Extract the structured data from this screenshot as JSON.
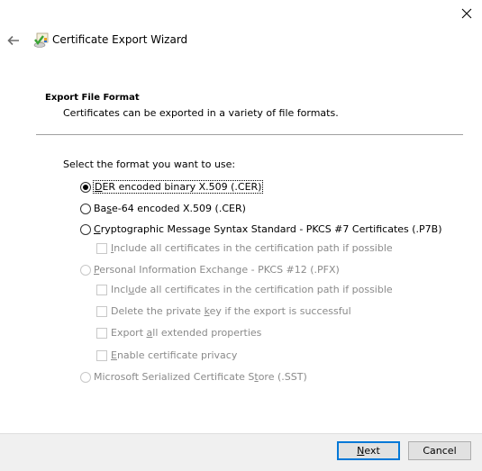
{
  "window": {
    "title": "Certificate Export Wizard",
    "back_icon": "arrow-left-icon",
    "close_icon": "close-icon",
    "app_icon": "certificate-export-icon"
  },
  "header": {
    "section_title": "Export File Format",
    "section_description": "Certificates can be exported in a variety of file formats."
  },
  "form": {
    "prompt": "Select the format you want to use:",
    "options": [
      {
        "label_accel": "D",
        "label_rest": "ER encoded binary X.509 (.CER)",
        "selected": true,
        "enabled": true
      },
      {
        "label_pre": "Ba",
        "label_accel": "s",
        "label_rest": "e-64 encoded X.509 (.CER)",
        "selected": false,
        "enabled": true
      },
      {
        "label_accel": "C",
        "label_rest": "ryptographic Message Syntax Standard - PKCS #7 Certificates (.P7B)",
        "selected": false,
        "enabled": true,
        "suboptions": [
          {
            "label_pre": "",
            "label_accel": "I",
            "label_rest": "nclude all certificates in the certification path if possible",
            "checked": false,
            "enabled": false
          }
        ]
      },
      {
        "label_accel": "P",
        "label_rest": "ersonal Information Exchange - PKCS #12 (.PFX)",
        "selected": false,
        "enabled": false,
        "suboptions": [
          {
            "label_pre": "Incl",
            "label_accel": "u",
            "label_rest": "de all certificates in the certification path if possible",
            "checked": false,
            "enabled": false
          },
          {
            "label_pre": "Delete the private ",
            "label_accel": "k",
            "label_rest": "ey if the export is successful",
            "checked": false,
            "enabled": false
          },
          {
            "label_pre": "Export ",
            "label_accel": "a",
            "label_rest": "ll extended properties",
            "checked": false,
            "enabled": false
          },
          {
            "label_pre": "",
            "label_accel": "E",
            "label_rest": "nable certificate privacy",
            "checked": false,
            "enabled": false
          }
        ]
      },
      {
        "label_pre": "Microsoft Serialized Certificate S",
        "label_accel": "t",
        "label_rest": "ore (.SST)",
        "selected": false,
        "enabled": false
      }
    ]
  },
  "footer": {
    "next_accel": "N",
    "next_rest": "ext",
    "cancel_label": "Cancel"
  },
  "colors": {
    "accent": "#0078d7",
    "footer_bg": "#f0f0f0",
    "disabled_text": "#8a8a8a"
  }
}
